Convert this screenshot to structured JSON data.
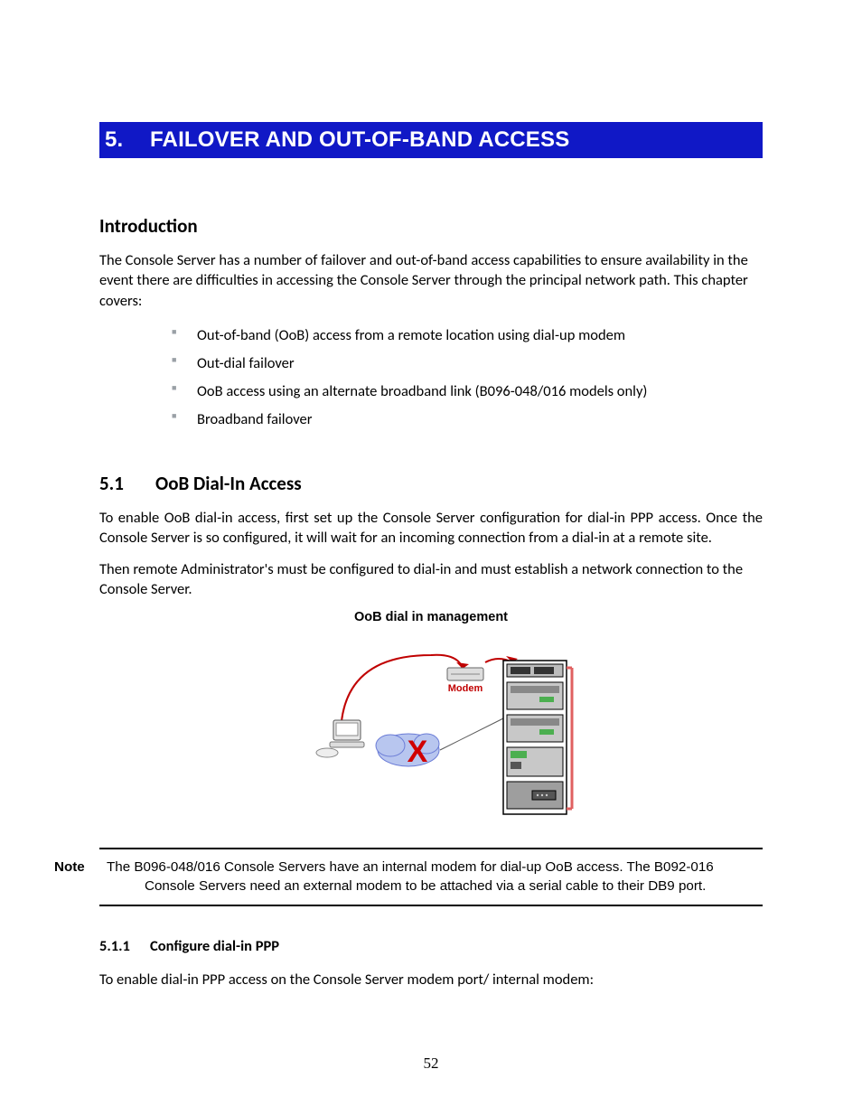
{
  "chapter": {
    "number": "5.",
    "title": "FAILOVER AND OUT-OF-BAND ACCESS"
  },
  "intro": {
    "heading": "Introduction",
    "para": "The Console Server has a number of failover and out-of-band access capabilities to ensure availability in the event there are difficulties in accessing the Console Server through the principal network path. This chapter covers:",
    "bullets": [
      "Out-of-band (OoB) access from a remote location using dial-up modem",
      "Out-dial failover",
      "OoB access using an alternate broadband link (B096-048/016 models only)",
      "Broadband failover"
    ]
  },
  "s51": {
    "num": "5.1",
    "title": "OoB Dial-In Access",
    "para1": "To enable OoB dial-in access, first set up the Console Server configuration for dial-in PPP access. Once the Console Server is so configured, it will wait for an incoming connection from a dial-in at a remote site.",
    "para2": "Then remote Administrator's must be configured to dial-in and must establish a network connection to the Console Server."
  },
  "diagram": {
    "title": "OoB dial in management",
    "modem_label": "Modem",
    "x_label": "X"
  },
  "note": {
    "label": "Note",
    "text": "The B096-048/016 Console Servers have an internal modem for dial-up OoB access. The B092-016 Console Servers need an external modem to be attached via a serial cable to their DB9 port."
  },
  "s511": {
    "num": "5.1.1",
    "title": "Configure dial-in PPP",
    "para": "To enable dial-in PPP access on the Console Server modem port/ internal modem:"
  },
  "page_number": "52"
}
